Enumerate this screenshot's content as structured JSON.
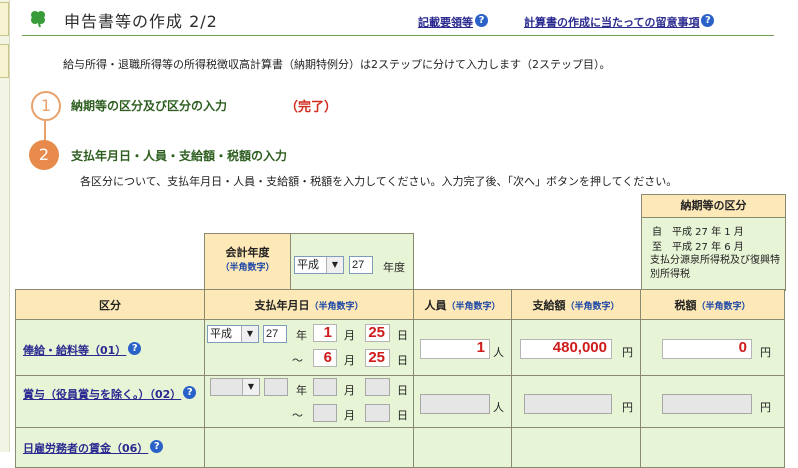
{
  "header": {
    "title": "申告書等の作成 2/2",
    "link1": "記載要領等",
    "link2": "計算書の作成に当たっての留意事項"
  },
  "intro": "給与所得・退職所得等の所得税徴収高計算書（納期特例分）は2ステップに分けて入力します（2ステップ目）。",
  "steps": [
    {
      "num": "1",
      "label": "納期等の区分及び区分の入力",
      "status": "（完了）"
    },
    {
      "num": "2",
      "label": "支払年月日・人員・支給額・税額の入力"
    }
  ],
  "step2_desc": "各区分について、支払年月日・人員・支給額・税額を入力してください。入力完了後、「次へ」ボタンを押してください。",
  "period_box": {
    "title": "納期等の区分",
    "from_prefix": "自",
    "from": "平成 27 年 1 月",
    "to_prefix": "至",
    "to": "平成 27 年 6 月",
    "type": "支払分源泉所得税及び復興特別所得税"
  },
  "fiscal_year": {
    "label": "会計年度",
    "hint": "（半角数字）",
    "era": "平成",
    "year": "27",
    "unit": "年度"
  },
  "columns": {
    "category": "区分",
    "pay_date": "支払年月日",
    "pay_date_hint": "（半角数字）",
    "people": "人員",
    "people_hint": "（半角数字）",
    "amount": "支給額",
    "amount_hint": "（半角数字）",
    "tax": "税額",
    "tax_hint": "（半角数字）"
  },
  "units": {
    "year": "年",
    "month": "月",
    "day": "日",
    "tilde": "～",
    "person": "人",
    "yen": "円"
  },
  "rows": [
    {
      "label": "俸給・給料等（01）",
      "era": "平成",
      "year": "27",
      "from_month": "1",
      "from_day": "25",
      "to_month": "6",
      "to_day": "25",
      "people": "1",
      "amount": "480,000",
      "tax": "0"
    },
    {
      "label": "賞与（役員賞与を除く。）（02）",
      "era": "",
      "year": "",
      "from_month": "",
      "from_day": "",
      "to_month": "",
      "to_day": "",
      "people": "",
      "amount": "",
      "tax": ""
    },
    {
      "label": "日雇労務者の賃金（06）"
    }
  ]
}
